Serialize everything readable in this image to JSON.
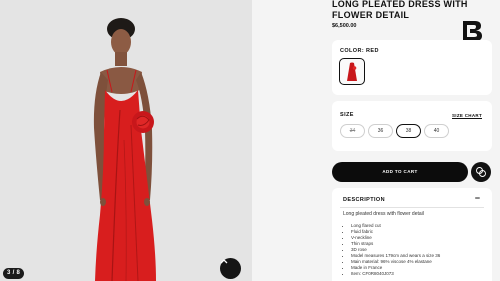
{
  "gallery": {
    "counter": "3 / 8",
    "colors": {
      "background": "#e4e4e4",
      "dress": "#d81e1e"
    }
  },
  "product": {
    "title": "LONG PLEATED DRESS WITH FLOWER DETAIL",
    "price": "$6,500.00",
    "brand_logo": "B"
  },
  "color": {
    "label": "COLOR: RED",
    "swatch_color": "#c8171b"
  },
  "size": {
    "label": "SIZE",
    "chart_link": "SIZE CHART",
    "options": [
      {
        "label": "34",
        "state": "unavailable"
      },
      {
        "label": "36",
        "state": "available"
      },
      {
        "label": "38",
        "state": "selected"
      },
      {
        "label": "40",
        "state": "available"
      }
    ]
  },
  "actions": {
    "add_to_cart": "ADD TO CART",
    "assist_icon": "chat-bubbles-icon"
  },
  "description": {
    "title": "DESCRIPTION",
    "toggle": "−",
    "intro": "Long pleated dress with flower detail",
    "items": [
      "Long flared cut",
      "Fluid fabric",
      "V-neckline",
      "Thin straps",
      "3D rose",
      "Model measures 179cm and wears a size 36",
      "Main material: 96% viscose 4% elastane",
      "Made in France",
      "Item: CF0R8040J073"
    ]
  }
}
